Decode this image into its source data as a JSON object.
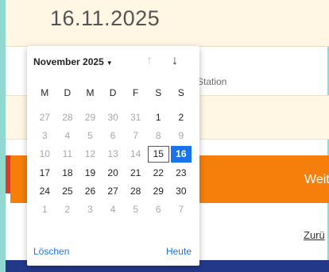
{
  "date_field": {
    "value": "16.11.2025"
  },
  "station": {
    "label": "Station"
  },
  "weiter_button": {
    "label": "Weit"
  },
  "zurueck_link": {
    "label": "Zurü"
  },
  "datepicker": {
    "month_label": "November 2025",
    "caret": "▼",
    "nav_up": "↑",
    "nav_down": "↓",
    "weekdays": [
      "M",
      "D",
      "M",
      "D",
      "F",
      "S",
      "S"
    ],
    "weeks": [
      [
        "27",
        "28",
        "29",
        "30",
        "31",
        "1",
        "2"
      ],
      [
        "3",
        "4",
        "5",
        "6",
        "7",
        "8",
        "9"
      ],
      [
        "10",
        "11",
        "12",
        "13",
        "14",
        "15",
        "16"
      ],
      [
        "17",
        "18",
        "19",
        "20",
        "21",
        "22",
        "23"
      ],
      [
        "24",
        "25",
        "26",
        "27",
        "28",
        "29",
        "30"
      ],
      [
        "1",
        "2",
        "3",
        "4",
        "5",
        "6",
        "7"
      ]
    ],
    "today": "15",
    "selected": "16",
    "clear_label": "Löschen",
    "today_label": "Heute",
    "colors": {
      "accent": "#1a73e8",
      "button": "#f57f0a",
      "footer": "#24388a"
    }
  }
}
